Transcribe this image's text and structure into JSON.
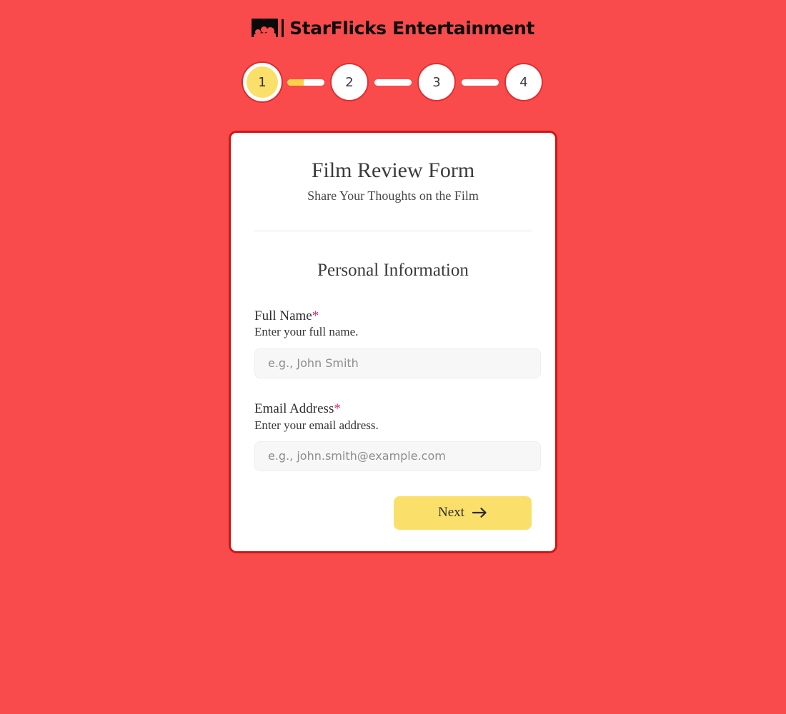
{
  "brand": {
    "icon": "audience-silhouette-icon",
    "name": "StarFlicks Entertainment"
  },
  "stepper": {
    "steps": [
      {
        "number": "1",
        "active": true
      },
      {
        "number": "2",
        "active": false
      },
      {
        "number": "3",
        "active": false
      },
      {
        "number": "4",
        "active": false
      }
    ],
    "connectors": [
      {
        "fill_percent": 45
      },
      {
        "fill_percent": 0
      },
      {
        "fill_percent": 0
      }
    ],
    "active_step": 1,
    "total_steps": 4
  },
  "form": {
    "title": "Film Review Form",
    "subtitle": "Share Your Thoughts on the Film",
    "section_title": "Personal Information",
    "fields": [
      {
        "label": "Full Name",
        "required_marker": "*",
        "help": "Enter your full name.",
        "placeholder": "e.g., John Smith",
        "value": ""
      },
      {
        "label": "Email Address",
        "required_marker": "*",
        "help": "Enter your email address.",
        "placeholder": "e.g., john.smith@example.com",
        "value": ""
      }
    ],
    "next_label": "Next",
    "next_icon": "arrow-right-icon"
  },
  "colors": {
    "background": "#f94b4b",
    "card_border": "#cf1616",
    "accent_yellow": "#fae06a",
    "required_pink": "#e8256b",
    "input_background": "#f7f7f7"
  }
}
